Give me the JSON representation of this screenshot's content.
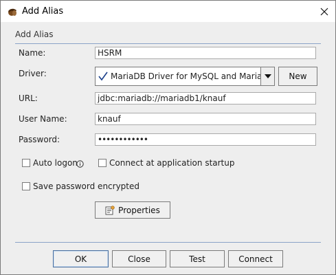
{
  "window": {
    "title": "Add Alias"
  },
  "section": {
    "label": "Add Alias"
  },
  "form": {
    "name_label": "Name:",
    "name_value": "HSRM",
    "driver_label": "Driver:",
    "driver_value": "MariaDB Driver for MySQL and MariaDB",
    "new_button": "New",
    "url_label": "URL:",
    "url_value": "jdbc:mariadb://mariadb1/knauf",
    "username_label": "User Name:",
    "username_value": "knauf",
    "password_label": "Password:",
    "password_value": "••••••••••••"
  },
  "options": {
    "auto_logon": {
      "label": "Auto logon",
      "checked": false
    },
    "connect_startup": {
      "label": "Connect at application startup",
      "checked": false
    },
    "save_password": {
      "label": "Save password encrypted",
      "checked": false
    }
  },
  "properties_button": "Properties",
  "footer": {
    "ok": "OK",
    "close": "Close",
    "test": "Test",
    "connect": "Connect"
  },
  "icons": {
    "app": "acorn-icon",
    "close": "close-icon",
    "driver_status": "checkmark-icon",
    "dropdown": "triangle-down-icon",
    "info": "info-icon",
    "properties": "properties-icon"
  },
  "colors": {
    "separator": "#8aa2c8",
    "checkmark": "#1a3f8a",
    "dialog_bg": "#eeeeee"
  }
}
